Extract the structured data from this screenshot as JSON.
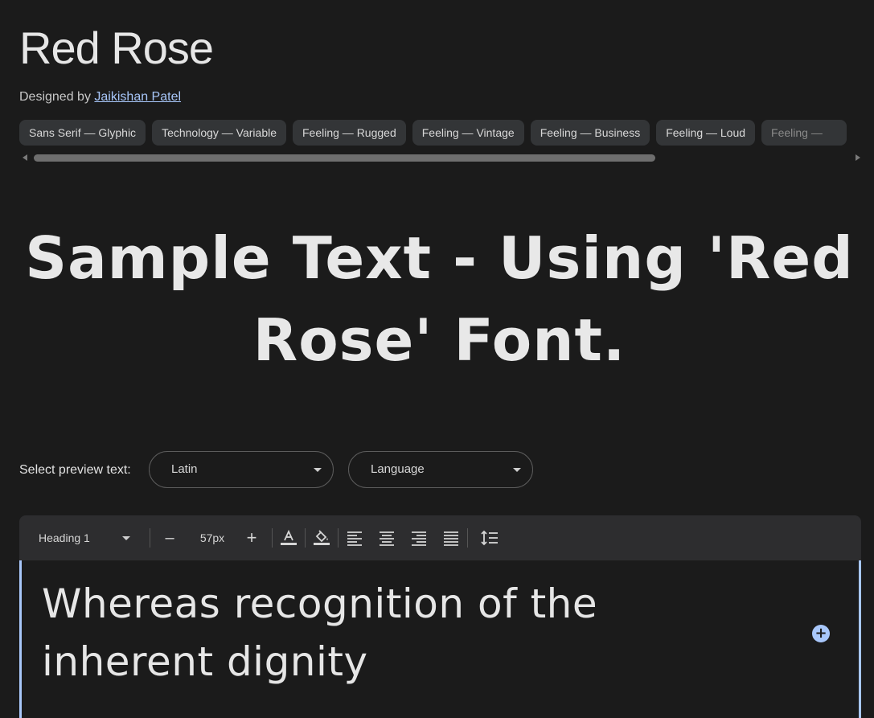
{
  "header": {
    "title": "Red Rose",
    "designed_by_label": "Designed by",
    "designer_name": "Jaikishan Patel"
  },
  "tags": [
    "Sans Serif — Glyphic",
    "Technology — Variable",
    "Feeling — Rugged",
    "Feeling — Vintage",
    "Feeling — Business",
    "Feeling — Loud",
    "Feeling —"
  ],
  "sample": {
    "text": "Sample Text - Using 'Red Rose' Font."
  },
  "preview": {
    "label": "Select preview text:",
    "script_select": "Latin",
    "language_select": "Language"
  },
  "toolbar": {
    "style_select": "Heading 1",
    "decrease_label": "–",
    "font_size": "57px",
    "increase_label": "+",
    "icons": [
      "text-color-icon",
      "highlight-color-icon",
      "align-left-icon",
      "align-center-icon",
      "align-right-icon",
      "align-justify-icon",
      "line-height-icon"
    ]
  },
  "editor": {
    "text": "Whereas recognition of the inherent dignity",
    "add_label": "+"
  },
  "colors": {
    "background": "#1b1b1b",
    "accent": "#a8c7fa",
    "chip": "#333537",
    "toolbar": "#2d2d2f"
  }
}
